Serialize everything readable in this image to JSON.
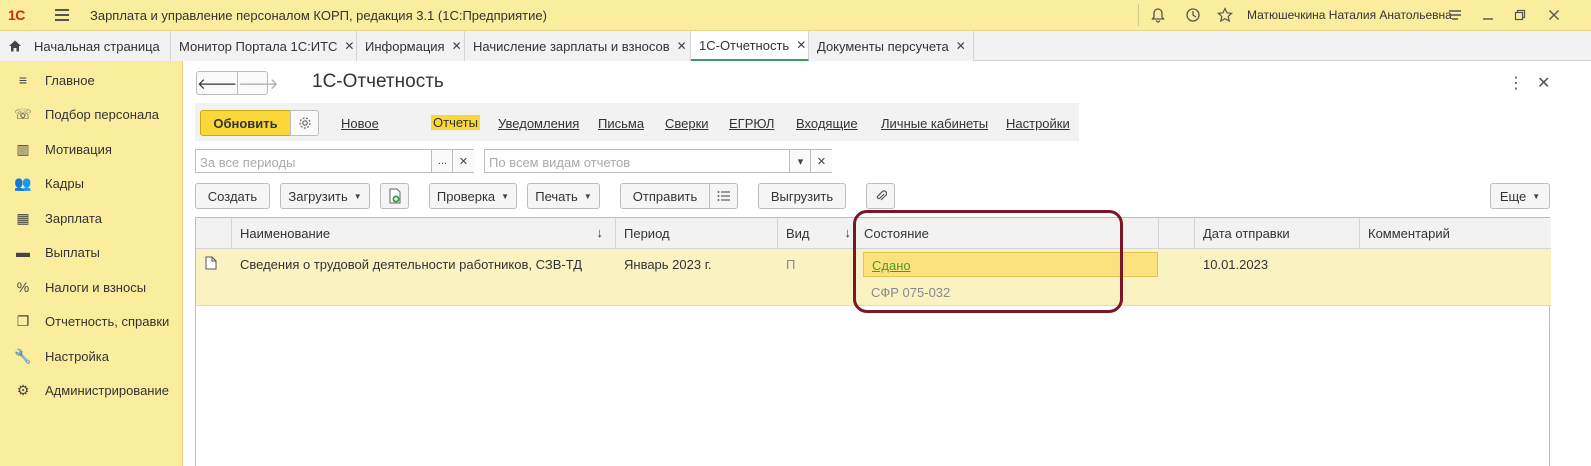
{
  "titlebar": {
    "logo": "1С",
    "app_title": "Зарплата и управление персоналом КОРП, редакция 3.1  (1С:Предприятие)",
    "user_name": "Матюшечкина Наталия Анатольевна"
  },
  "tabs": [
    {
      "label": "Начальная страница"
    },
    {
      "label": "Монитор Портала 1С:ИТС"
    },
    {
      "label": "Информация"
    },
    {
      "label": "Начисление зарплаты и взносов"
    },
    {
      "label": "1С-Отчетность"
    },
    {
      "label": "Документы персучета"
    }
  ],
  "sidebar": {
    "items": [
      {
        "label": "Главное",
        "icon": "list-icon"
      },
      {
        "label": "Подбор персонала",
        "icon": "recruit-icon"
      },
      {
        "label": "Мотивация",
        "icon": "gift-icon"
      },
      {
        "label": "Кадры",
        "icon": "people-icon"
      },
      {
        "label": "Зарплата",
        "icon": "calculator-icon"
      },
      {
        "label": "Выплаты",
        "icon": "wallet-icon"
      },
      {
        "label": "Налоги и взносы",
        "icon": "percent-icon"
      },
      {
        "label": "Отчетность, справки",
        "icon": "reports-icon"
      },
      {
        "label": "Настройка",
        "icon": "wrench-icon"
      },
      {
        "label": "Администрирование",
        "icon": "gear-icon"
      }
    ]
  },
  "page": {
    "title": "1С-Отчетность"
  },
  "commands": {
    "refresh": "Обновить",
    "links": [
      "Новое",
      "Отчеты",
      "Уведомления",
      "Письма",
      "Сверки",
      "ЕГРЮЛ",
      "Входящие",
      "Личные кабинеты",
      "Настройки"
    ]
  },
  "filters": {
    "period_placeholder": "За все периоды",
    "period_select": "...",
    "kind_placeholder": "По всем видам отчетов"
  },
  "toolbar": {
    "create": "Создать",
    "load": "Загрузить",
    "check": "Проверка",
    "print": "Печать",
    "send": "Отправить",
    "export": "Выгрузить",
    "more": "Еще"
  },
  "table": {
    "columns": [
      "Наименование",
      "Период",
      "Вид",
      "Состояние",
      "Дата отправки",
      "Комментарий"
    ],
    "rows": [
      {
        "name": "Сведения о трудовой деятельности работников, СЗВ-ТД",
        "period": "Январь 2023 г.",
        "kind": "П",
        "status": "Сдано",
        "recipient": "СФР 075-032",
        "sent_date": "10.01.2023",
        "comment": ""
      }
    ]
  },
  "colors": {
    "accent_yellow": "#fbd739",
    "panel_yellow": "#fbed9e",
    "highlight_frame": "#7a1626",
    "status_green": "#4a9a2a"
  }
}
